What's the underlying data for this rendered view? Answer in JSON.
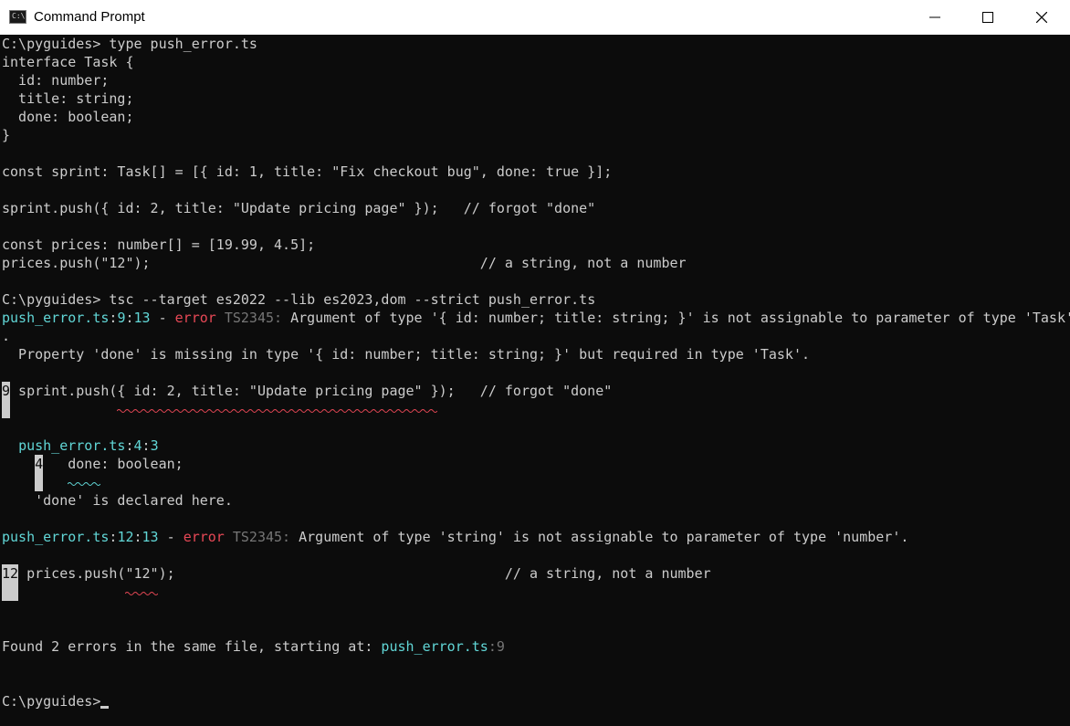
{
  "window": {
    "title": "Command Prompt",
    "icon_text": "C:\\",
    "controls": {
      "minimize": "minimize-icon",
      "maximize": "maximize-icon",
      "close": "close-icon"
    }
  },
  "colors": {
    "background": "#0c0c0c",
    "text": "#cccccc",
    "filename": "#61d6d6",
    "error": "#e74856",
    "code": "#767676",
    "squiggle": "#e74856",
    "squiggle_info": "#61d6d6"
  },
  "terminal": {
    "cmd1": {
      "prompt": "C:\\pyguides>",
      "command": " type push_error.ts"
    },
    "source": [
      "interface Task {",
      "  id: number;",
      "  title: string;",
      "  done: boolean;",
      "}",
      "const sprint: Task[] = [{ id: 1, title: \"Fix checkout bug\", done: true }];",
      "sprint.push({ id: 2, title: \"Update pricing page\" });   // forgot \"done\"",
      "const prices: number[] = [19.99, 4.5];",
      "prices.push(\"12\");                                        // a string, not a number"
    ],
    "cmd2": {
      "prompt": "C:\\pyguides>",
      "command": " tsc --target es2022 --lib es2023,dom --strict push_error.ts"
    },
    "error1": {
      "file": "push_error.ts",
      "sep": ":",
      "line": "9",
      "col": "13",
      "dash": " - ",
      "level": "error",
      "code": " TS2345:",
      "message": " Argument of type '{ id: number; title: string; }' is not assignable to parameter of type 'Task'",
      "wrap": ".",
      "detail": "  Property 'done' is missing in type '{ id: number; title: string; }' but required in type 'Task'.",
      "gutter": "9",
      "snippet": " sprint.push({ id: 2, title: \"Update pricing page\" });   // forgot \"done\"",
      "related": {
        "indent": "  ",
        "file": "push_error.ts",
        "sep": ":",
        "line": "4",
        "col": "3",
        "pad": "    ",
        "gutter": "4",
        "snippet": "   done: boolean;",
        "note": "    'done' is declared here."
      }
    },
    "error2": {
      "file": "push_error.ts",
      "sep": ":",
      "line": "12",
      "col": "13",
      "dash": " - ",
      "level": "error",
      "code": " TS2345:",
      "message": " Argument of type 'string' is not assignable to parameter of type 'number'.",
      "gutter": "12",
      "snippet": " prices.push(\"12\");                                        // a string, not a number"
    },
    "summary": {
      "text": "Found 2 errors in the same file, starting at: ",
      "file": "push_error.ts",
      "sep": ":",
      "line": "9"
    },
    "cmd3": {
      "prompt": "C:\\pyguides>"
    }
  }
}
